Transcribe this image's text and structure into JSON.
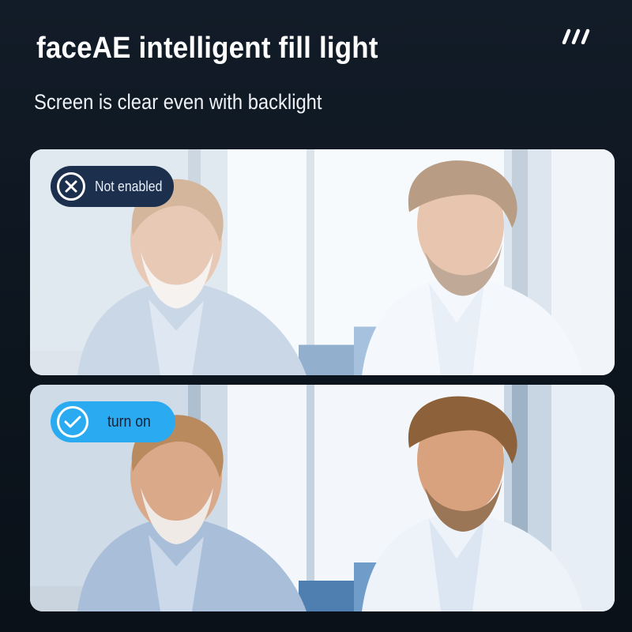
{
  "header": {
    "title": "faceAE intelligent fill light",
    "subtitle": "Screen is clear even with backlight"
  },
  "decor": {
    "slashes_icon": "triple-slash-icon"
  },
  "comparison": [
    {
      "state_label": "Not enabled",
      "icon": "x-circle-icon",
      "badge_color": "#1c2f4d",
      "washed_out": true
    },
    {
      "state_label": "turn on",
      "icon": "check-circle-icon",
      "badge_color": "#2aaaf0",
      "washed_out": false
    }
  ]
}
